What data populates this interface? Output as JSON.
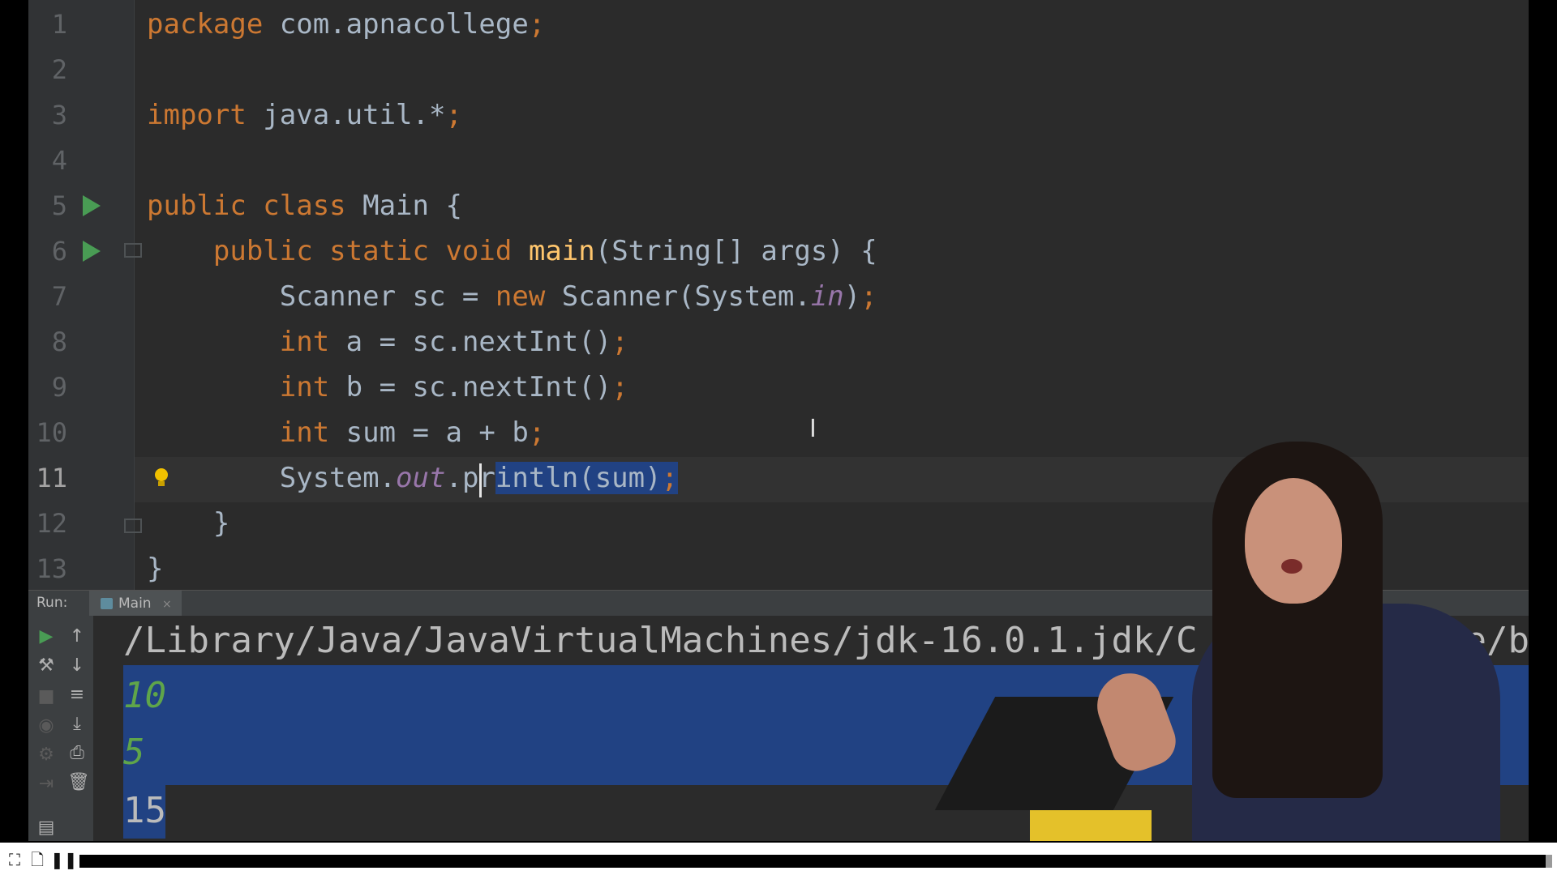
{
  "editor": {
    "line_numbers": [
      "1",
      "2",
      "3",
      "4",
      "5",
      "6",
      "7",
      "8",
      "9",
      "10",
      "11",
      "12",
      "13"
    ],
    "lines": [
      [
        {
          "t": "package",
          "c": "kw"
        },
        {
          "t": " com.apnacollege"
        },
        {
          "t": ";",
          "c": "kw"
        }
      ],
      [],
      [
        {
          "t": "import",
          "c": "kw"
        },
        {
          "t": " java.util.*"
        },
        {
          "t": ";",
          "c": "kw"
        }
      ],
      [],
      [
        {
          "t": "public class",
          "c": "kw"
        },
        {
          "t": " Main {"
        }
      ],
      [
        {
          "t": "    "
        },
        {
          "t": "public static void",
          "c": "kw"
        },
        {
          "t": " "
        },
        {
          "t": "main",
          "c": "fn"
        },
        {
          "t": "(String[] args) {"
        }
      ],
      [
        {
          "t": "        Scanner sc = "
        },
        {
          "t": "new",
          "c": "kw"
        },
        {
          "t": " Scanner(System."
        },
        {
          "t": "in",
          "c": "st"
        },
        {
          "t": ")"
        },
        {
          "t": ";",
          "c": "kw"
        }
      ],
      [
        {
          "t": "        "
        },
        {
          "t": "int",
          "c": "kw"
        },
        {
          "t": " a = sc.nextInt()"
        },
        {
          "t": ";",
          "c": "kw"
        }
      ],
      [
        {
          "t": "        "
        },
        {
          "t": "int",
          "c": "kw"
        },
        {
          "t": " b = sc.nextInt()"
        },
        {
          "t": ";",
          "c": "kw"
        }
      ],
      [
        {
          "t": "        "
        },
        {
          "t": "int",
          "c": "kw"
        },
        {
          "t": " sum = a + b"
        },
        {
          "t": ";",
          "c": "kw"
        }
      ],
      [
        {
          "t": "        System."
        },
        {
          "t": "out",
          "c": "st"
        },
        {
          "t": ".pr"
        },
        {
          "t": "intln(sum)",
          "c": "sel"
        },
        {
          "t": ";",
          "c": "kw sel"
        }
      ],
      [
        {
          "t": "    }"
        }
      ],
      [
        {
          "t": "}"
        }
      ]
    ],
    "run_gutter_lines": [
      5,
      6
    ],
    "current_line": 11
  },
  "run_panel": {
    "label": "Run:",
    "tab_label": "Main",
    "tab_close": "×"
  },
  "console": {
    "path": "/Library/Java/JavaVirtualMachines/jdk-16.0.1.jdk/C",
    "path_tail": "e/bi",
    "input_1": "10",
    "input_2": "5",
    "output": "15"
  },
  "colors": {
    "keyword": "#cc7832",
    "function": "#ffc66d",
    "static_field": "#9876aa",
    "selection": "#214283",
    "run_icon": "#499c54",
    "console_input": "#5fa54a"
  },
  "player": {
    "progress": 1.0
  }
}
